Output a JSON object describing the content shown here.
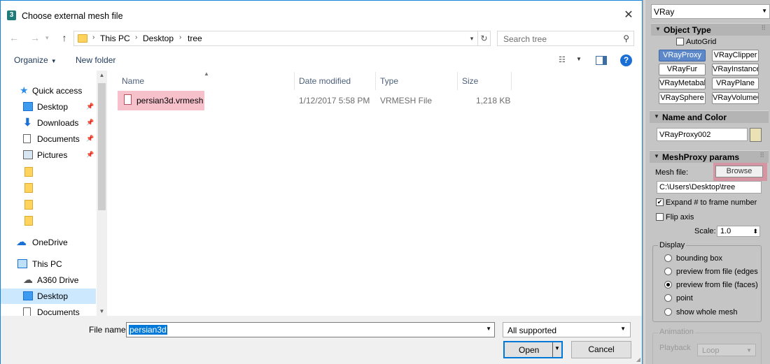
{
  "dialog": {
    "title": "Choose external mesh file",
    "close_glyph": "✕",
    "address": {
      "segments": [
        "This PC",
        "Desktop",
        "tree"
      ],
      "sep": "›"
    },
    "search_placeholder": "Search tree",
    "toolbar": {
      "organize": "Organize",
      "new_folder": "New folder",
      "help": "?"
    },
    "nav": [
      {
        "label": "Quick access",
        "icon": "star-icon"
      },
      {
        "label": "Desktop",
        "icon": "desktop-icon",
        "pinned": true
      },
      {
        "label": "Downloads",
        "icon": "download-icon",
        "pinned": true
      },
      {
        "label": "Documents",
        "icon": "documents-icon",
        "pinned": true
      },
      {
        "label": "Pictures",
        "icon": "pictures-icon",
        "pinned": true
      },
      {
        "label": "",
        "icon": "folder-icon"
      },
      {
        "label": "",
        "icon": "folder-icon"
      },
      {
        "label": "",
        "icon": "folder-icon"
      },
      {
        "label": "",
        "icon": "folder-icon"
      },
      {
        "label": "OneDrive",
        "icon": "cloud-icon"
      },
      {
        "label": "This PC",
        "icon": "computer-icon"
      },
      {
        "label": "A360 Drive",
        "icon": "a360-drive-icon"
      },
      {
        "label": "Desktop",
        "icon": "desktop-icon",
        "selected": true
      },
      {
        "label": "Documents",
        "icon": "documents-icon"
      }
    ],
    "columns": [
      "Name",
      "Date modified",
      "Type",
      "Size"
    ],
    "files": [
      {
        "name": "persian3d.vrmesh",
        "date": "1/12/2017 5:58 PM",
        "type": "VRMESH File",
        "size": "1,218 KB",
        "highlight_color": "#e95b78"
      }
    ],
    "file_name_label": "File name:",
    "file_name_value": "persian3d",
    "filter_value": "All supported",
    "open_label": "Open",
    "cancel_label": "Cancel",
    "accent_color": "#0078d7"
  },
  "panel": {
    "top_dropdown": "VRay",
    "object_type": {
      "title": "Object Type",
      "autogrid": "AutoGrid",
      "buttons": [
        "VRayProxy",
        "VRayClipper",
        "VRayFur",
        "VRayInstancer",
        "VRayMetaball",
        "VRayPlane",
        "VRaySphere",
        "VRayVolumeGrid"
      ],
      "active_button": "VRayProxy"
    },
    "name_and_color": {
      "title": "Name and Color",
      "name_value": "VRayProxy002",
      "swatch_color": "#eae2b4"
    },
    "meshproxy": {
      "title": "MeshProxy params",
      "mesh_file_label": "Mesh file:",
      "browse": "Browse",
      "path_value": "C:\\Users\\Desktop\\tree",
      "expand_label": "Expand # to frame number",
      "expand_checked": true,
      "flip_label": "Flip axis",
      "flip_checked": false,
      "scale_label": "Scale:",
      "scale_value": "1.0",
      "display_title": "Display",
      "display_options": [
        "bounding box",
        "preview from file (edges",
        "preview from file (faces)",
        "point",
        "show whole mesh"
      ],
      "display_selected": "preview from file (faces)",
      "animation_title": "Animation",
      "playback_label": "Playback",
      "playback_value": "Loop"
    }
  }
}
